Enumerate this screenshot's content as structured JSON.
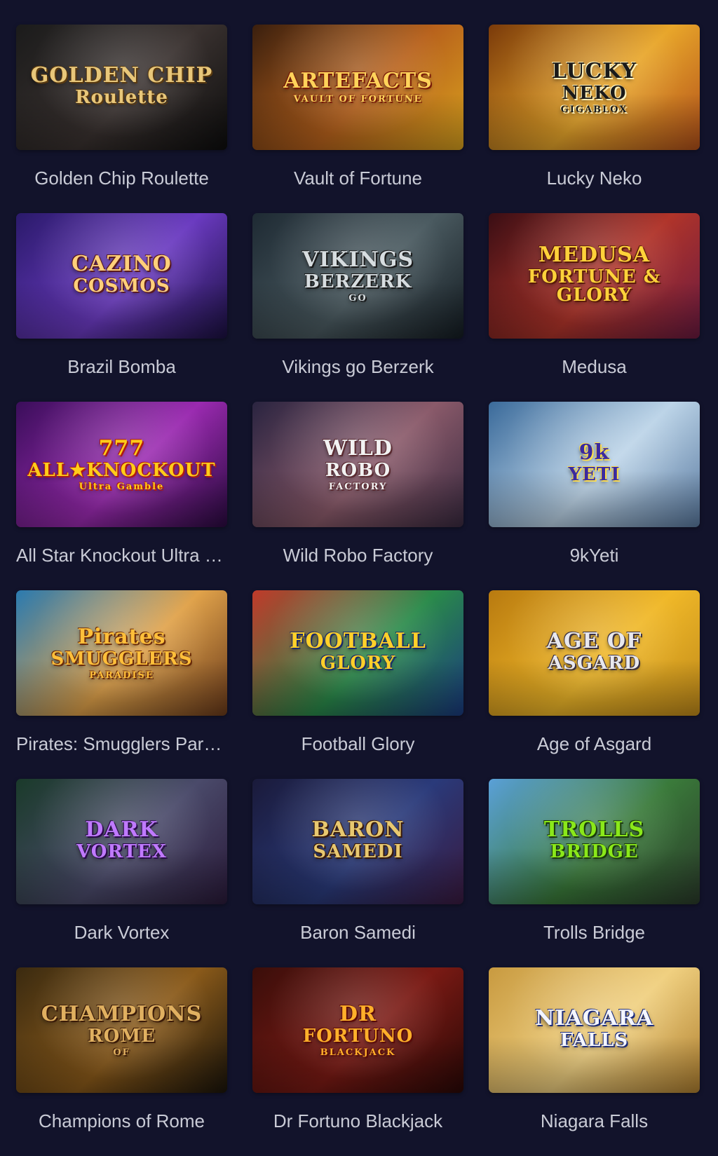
{
  "games": [
    {
      "id": "golden-chip-roulette",
      "title": "Golden Chip Roulette",
      "logo": [
        "GOLDEN CHIP",
        "Roulette",
        ""
      ],
      "bg": [
        "#1b1b1b",
        "#3a3230",
        "#0d0d0d"
      ],
      "logo_color": "#e8c77a",
      "logo_shadow": "#5a3a10"
    },
    {
      "id": "vault-of-fortune",
      "title": "Vault of Fortune",
      "logo": [
        "ARTEFACTS",
        "",
        "VAULT OF FORTUNE"
      ],
      "bg": [
        "#3a1f0e",
        "#b8621c",
        "#d9a21e"
      ],
      "logo_color": "#ffd35a",
      "logo_shadow": "#7a1a08"
    },
    {
      "id": "lucky-neko",
      "title": "Lucky Neko",
      "logo": [
        "LUCKY",
        "NEKO",
        "GIGABLOX"
      ],
      "bg": [
        "#7a3a0a",
        "#e8a62a",
        "#b2501a"
      ],
      "logo_color": "#1a1a1a",
      "logo_shadow": "#fff4c0"
    },
    {
      "id": "brazil-bomba",
      "title": "Brazil Bomba",
      "logo": [
        "CAZINO",
        "COSMOS",
        ""
      ],
      "bg": [
        "#2a1a6a",
        "#6a3ac0",
        "#1a1040"
      ],
      "logo_color": "#ffcf7a",
      "logo_shadow": "#5a1a20"
    },
    {
      "id": "vikings-go-berzerk",
      "title": "Vikings go Berzerk",
      "logo": [
        "VIKINGS",
        "BERZERK",
        "GO"
      ],
      "bg": [
        "#1e2a33",
        "#4a5a60",
        "#141c22"
      ],
      "logo_color": "#d7dde0",
      "logo_shadow": "#1a1a1a"
    },
    {
      "id": "medusa",
      "title": "Medusa",
      "logo": [
        "MEDUSA",
        "FORTUNE & GLORY",
        ""
      ],
      "bg": [
        "#3a0e14",
        "#b0342a",
        "#6a1a40"
      ],
      "logo_color": "#ffd23a",
      "logo_shadow": "#5a1a08"
    },
    {
      "id": "all-star-knockout",
      "title": "All Star Knockout Ultra Gamble",
      "logo": [
        "777",
        "ALL★KNOCKOUT",
        "Ultra Gamble"
      ],
      "bg": [
        "#3a0e5a",
        "#9a2ab0",
        "#2a0a40"
      ],
      "logo_color": "#ffcc1a",
      "logo_shadow": "#b01a10"
    },
    {
      "id": "wild-robo-factory",
      "title": "Wild Robo Factory",
      "logo": [
        "WILD",
        "ROBO",
        "FACTORY"
      ],
      "bg": [
        "#2a2440",
        "#8a5a6a",
        "#3a2a40"
      ],
      "logo_color": "#f2f2f2",
      "logo_shadow": "#5a2a30"
    },
    {
      "id": "9k-yeti",
      "title": "9kYeti",
      "logo": [
        "9k",
        "YETI",
        ""
      ],
      "bg": [
        "#3a6a9a",
        "#bcd4e8",
        "#5a7aa0"
      ],
      "logo_color": "#3a2aa0",
      "logo_shadow": "#ffe04a"
    },
    {
      "id": "pirates-smugglers-paradise",
      "title": "Pirates: Smugglers Paradise",
      "logo": [
        "Pirates",
        "SMUGGLERS",
        "PARADISE"
      ],
      "bg": [
        "#2a7ab0",
        "#e0a24a",
        "#6a3a1a"
      ],
      "logo_color": "#ffbf3a",
      "logo_shadow": "#6a2a08"
    },
    {
      "id": "football-glory",
      "title": "Football Glory",
      "logo": [
        "FOOTBALL",
        "GLORY",
        ""
      ],
      "bg": [
        "#c03a2a",
        "#2a8a4a",
        "#1a3a80"
      ],
      "logo_color": "#ffd02a",
      "logo_shadow": "#1a2a6a"
    },
    {
      "id": "age-of-asgard",
      "title": "Age of Asgard",
      "logo": [
        "AGE OF",
        "ASGARD",
        ""
      ],
      "bg": [
        "#b87a10",
        "#f0b828",
        "#c08a1a"
      ],
      "logo_color": "#e8e8ee",
      "logo_shadow": "#3a3040"
    },
    {
      "id": "dark-vortex",
      "title": "Dark Vortex",
      "logo": [
        "DARK",
        "VORTEX",
        ""
      ],
      "bg": [
        "#1a3a2a",
        "#4a4a6a",
        "#2a1a3a"
      ],
      "logo_color": "#c07aff",
      "logo_shadow": "#2a0a4a"
    },
    {
      "id": "baron-samedi",
      "title": "Baron Samedi",
      "logo": [
        "BARON",
        "SAMEDI",
        ""
      ],
      "bg": [
        "#1a1a3a",
        "#2a3a7a",
        "#3a1a40"
      ],
      "logo_color": "#e8c870",
      "logo_shadow": "#3a1a08"
    },
    {
      "id": "trolls-bridge",
      "title": "Trolls Bridge",
      "logo": [
        "TROLLS",
        "BRIDGE",
        ""
      ],
      "bg": [
        "#5aa0d8",
        "#3a7a3a",
        "#2a3a2a"
      ],
      "logo_color": "#8ae81a",
      "logo_shadow": "#1a3a0a"
    },
    {
      "id": "champions-of-rome",
      "title": "Champions of Rome",
      "logo": [
        "CHAMPIONS",
        "ROME",
        "OF"
      ],
      "bg": [
        "#3a2a10",
        "#8a5a1a",
        "#1a140a"
      ],
      "logo_color": "#e0b060",
      "logo_shadow": "#3a1a08"
    },
    {
      "id": "dr-fortuno-blackjack",
      "title": "Dr Fortuno Blackjack",
      "logo": [
        "DR",
        "FORTUNO",
        "BLACKJACK"
      ],
      "bg": [
        "#3a0e0a",
        "#7a1a14",
        "#2a0806"
      ],
      "logo_color": "#ffb02a",
      "logo_shadow": "#5a0a08"
    },
    {
      "id": "niagara-falls",
      "title": "Niagara Falls",
      "logo": [
        "NIAGARA",
        "FALLS",
        ""
      ],
      "bg": [
        "#c89a40",
        "#f0d080",
        "#b08030"
      ],
      "logo_color": "#f4f6ff",
      "logo_shadow": "#1a2a7a"
    }
  ]
}
